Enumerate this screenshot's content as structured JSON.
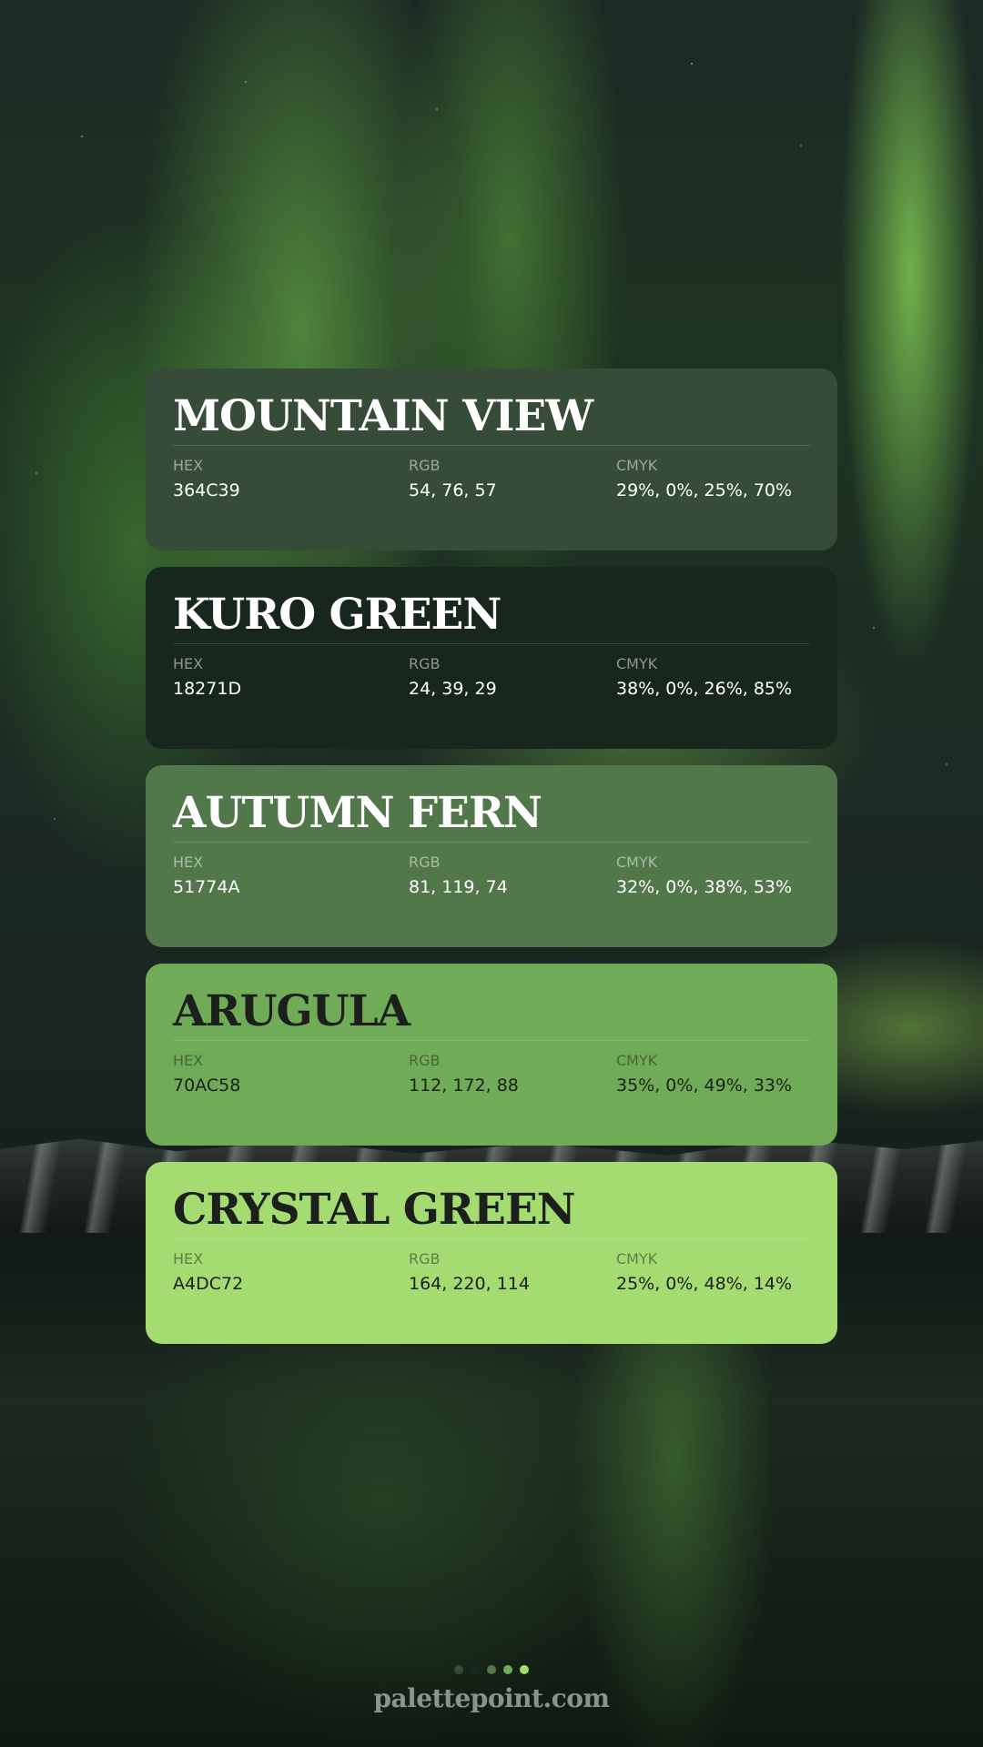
{
  "palette": {
    "swatches": [
      {
        "name": "MOUNTAIN VIEW",
        "color": "#364C39",
        "text_color": "#ffffff",
        "hex_label": "HEX",
        "hex": "364C39",
        "rgb_label": "RGB",
        "rgb": "54, 76, 57",
        "cmyk_label": "CMYK",
        "cmyk": "29%, 0%, 25%, 70%"
      },
      {
        "name": "KURO GREEN",
        "color": "#18271D",
        "text_color": "#ffffff",
        "hex_label": "HEX",
        "hex": "18271D",
        "rgb_label": "RGB",
        "rgb": "24, 39, 29",
        "cmyk_label": "CMYK",
        "cmyk": "38%, 0%, 26%, 85%"
      },
      {
        "name": "AUTUMN FERN",
        "color": "#51774A",
        "text_color": "#ffffff",
        "hex_label": "HEX",
        "hex": "51774A",
        "rgb_label": "RGB",
        "rgb": "81, 119, 74",
        "cmyk_label": "CMYK",
        "cmyk": "32%, 0%, 38%, 53%"
      },
      {
        "name": "ARUGULA",
        "color": "#70AC58",
        "text_color": "#1c1f1c",
        "hex_label": "HEX",
        "hex": "70AC58",
        "rgb_label": "RGB",
        "rgb": "112, 172, 88",
        "cmyk_label": "CMYK",
        "cmyk": "35%, 0%, 49%, 33%"
      },
      {
        "name": "CRYSTAL GREEN",
        "color": "#A4DC72",
        "text_color": "#1c1f1c",
        "hex_label": "HEX",
        "hex": "A4DC72",
        "rgb_label": "RGB",
        "rgb": "164, 220, 114",
        "cmyk_label": "CMYK",
        "cmyk": "25%, 0%, 48%, 14%"
      }
    ]
  },
  "pagination": {
    "dot_colors": [
      "#364C39",
      "#18271D",
      "#51774A",
      "#70AC58",
      "#A4DC72"
    ]
  },
  "footer": {
    "brand": "palettepoint.com"
  }
}
